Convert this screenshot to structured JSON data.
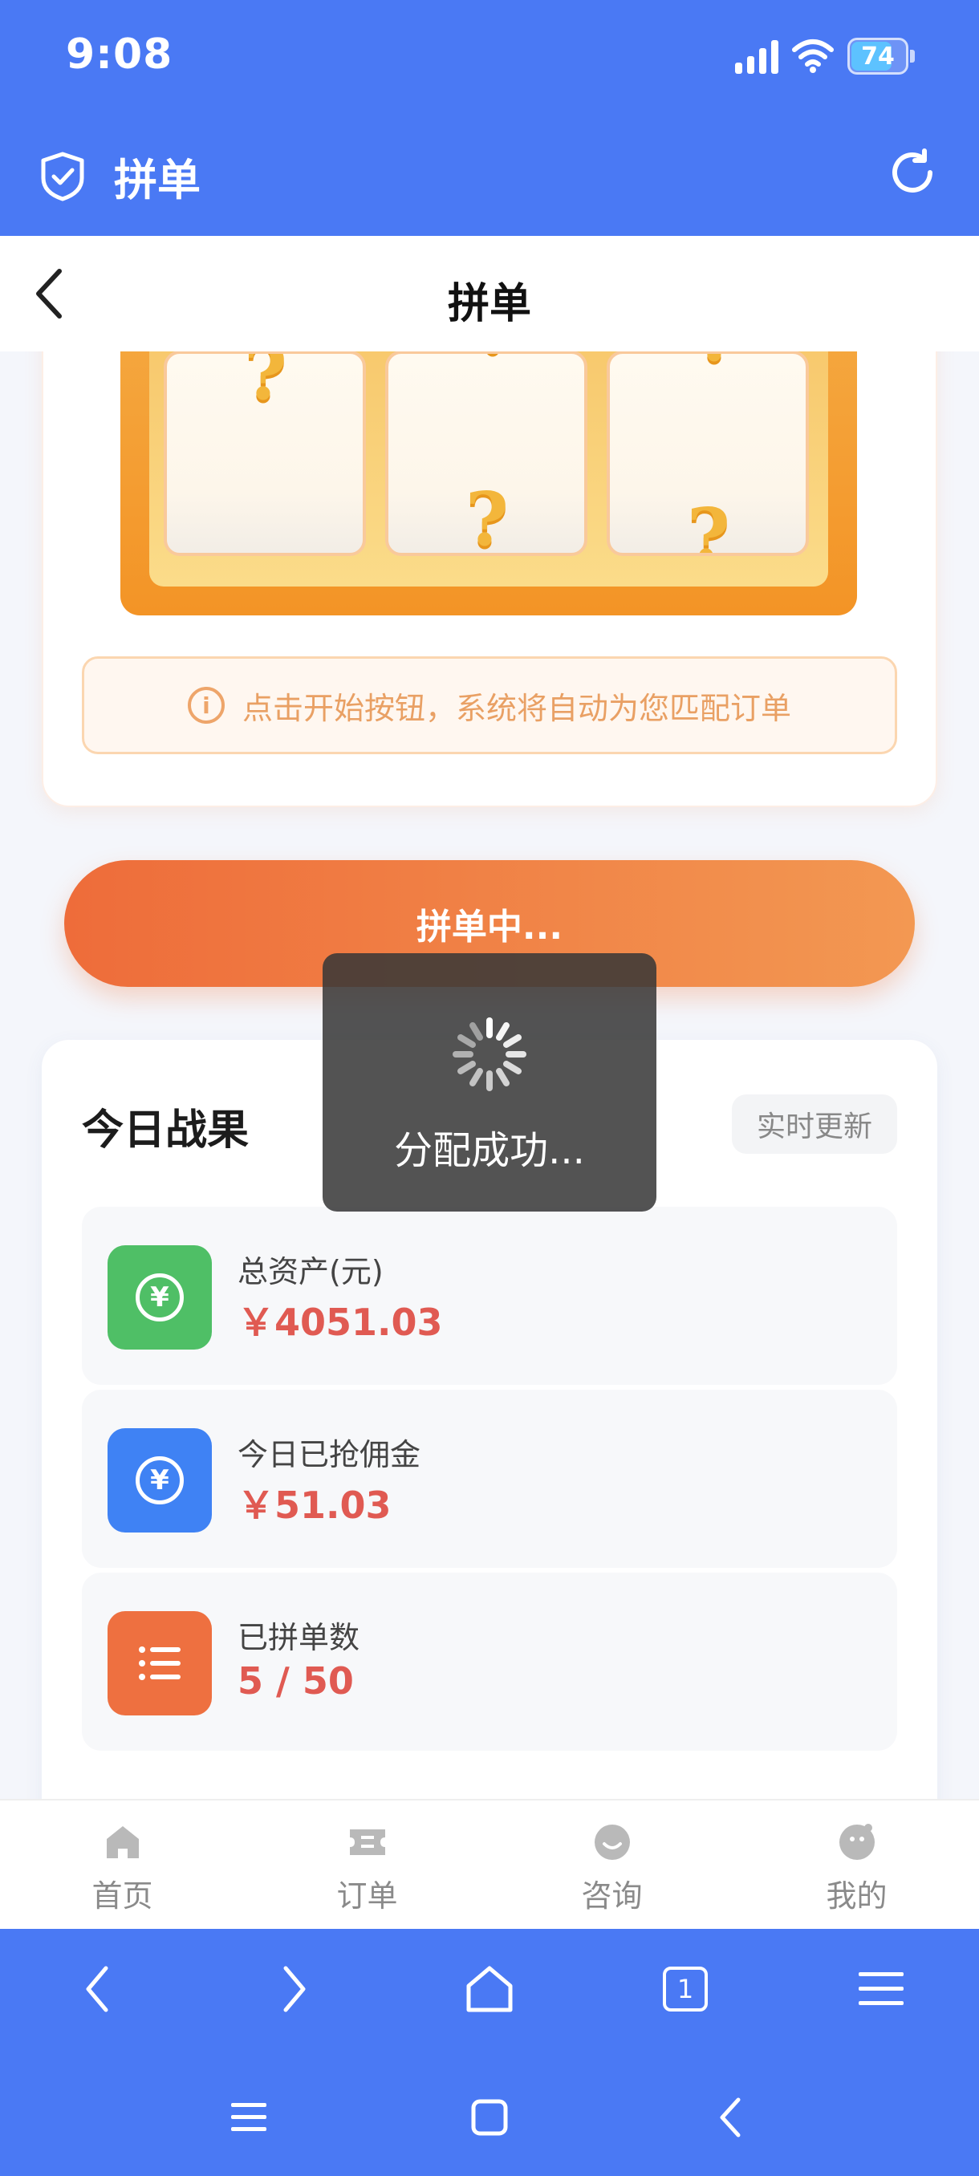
{
  "status": {
    "time": "9:08",
    "battery": "74"
  },
  "app": {
    "title": "拼单"
  },
  "page": {
    "title": "拼单"
  },
  "draw": {
    "qmark": "?",
    "tip": "点击开始按钮，系统将自动为您匹配订单"
  },
  "main_button": {
    "label": "拼单中..."
  },
  "toast": {
    "text": "分配成功..."
  },
  "stats": {
    "title": "今日战果",
    "badge": "实时更新",
    "items": [
      {
        "label": "总资产(元)",
        "value": "￥4051.03",
        "icon": "yen-icon",
        "color": "#4fbf66"
      },
      {
        "label": "今日已抢佣金",
        "value": "￥51.03",
        "icon": "yen-icon",
        "color": "#3f82f4"
      },
      {
        "label": "已拼单数",
        "value": "5 / 50",
        "icon": "list-icon",
        "color": "#ee7040"
      }
    ]
  },
  "tabs": [
    {
      "label": "首页",
      "icon": "home-icon"
    },
    {
      "label": "订单",
      "icon": "ticket-icon"
    },
    {
      "label": "咨询",
      "icon": "chat-icon"
    },
    {
      "label": "我的",
      "icon": "profile-icon"
    }
  ],
  "browser": {
    "tab_count": "1"
  },
  "colors": {
    "brand_blue": "#4a79f4",
    "accent_orange": "#ee6c3a",
    "value_red": "#e05a52"
  }
}
